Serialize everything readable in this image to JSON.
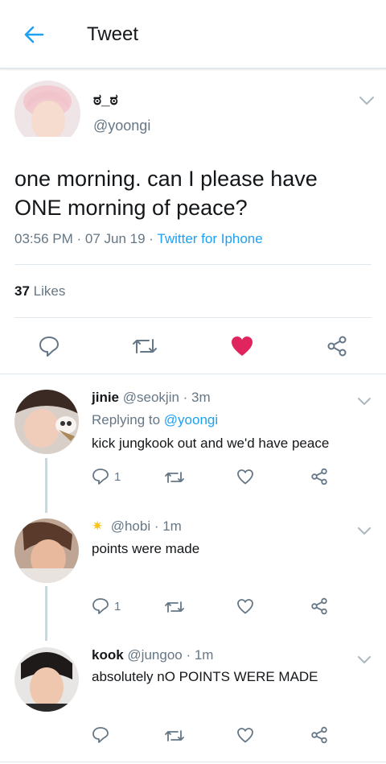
{
  "header": {
    "title": "Tweet"
  },
  "tweet": {
    "display_name": "ಠ_ಠ",
    "handle": "@yoongi",
    "text": "one morning. can I please have ONE morning of peace?",
    "time": "03:56 PM",
    "date": "07 Jun 19",
    "source": "Twitter for Iphone",
    "likes_count": "37",
    "likes_label": "Likes",
    "liked": true
  },
  "replies": [
    {
      "name": "jinie",
      "handle": "@seokjin",
      "time": "3m",
      "replying_label": "Replying to",
      "replying_to": "@yoongi",
      "text": "kick jungkook out and we'd have peace",
      "reply_count": "1"
    },
    {
      "name": "",
      "emoji": "✷",
      "handle": "@hobi",
      "time": "1m",
      "text": "points were made",
      "reply_count": "1"
    },
    {
      "name": "kook",
      "handle": "@jungoo",
      "time": "1m",
      "text": "absolutely nO POINTS WERE MADE",
      "reply_count": ""
    }
  ],
  "colors": {
    "accent": "#1da1f2",
    "like": "#e0245e",
    "muted": "#657786",
    "text": "#14171a"
  },
  "icons": [
    "back-arrow-icon",
    "chevron-down-icon",
    "reply-icon",
    "retweet-icon",
    "heart-icon",
    "share-icon"
  ]
}
